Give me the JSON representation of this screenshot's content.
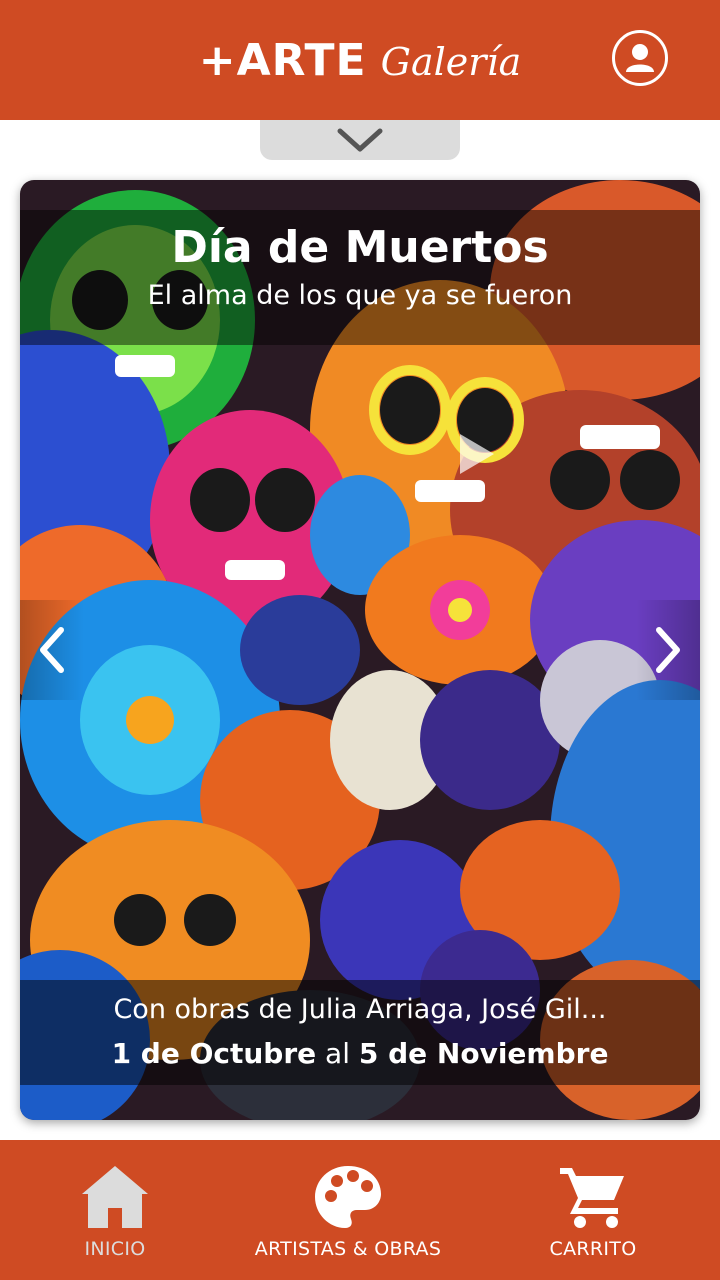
{
  "header": {
    "brand_main": "+ARTE",
    "brand_sub": "Galería",
    "user_icon": "user-profile-icon"
  },
  "pull_tab": {
    "icon": "chevron-down-icon"
  },
  "featured": {
    "title": "Día de Muertos",
    "subtitle": "El alma de los que ya se fueron",
    "artists": "Con obras de Julia Arriaga, José Gil...",
    "date_start": "1 de Octubre",
    "date_connector": "al",
    "date_end": "5 de Noviembre",
    "prev_icon": "chevron-left-icon",
    "next_icon": "chevron-right-icon",
    "play_icon": "play-icon"
  },
  "nav": {
    "items": [
      {
        "label": "INICIO",
        "icon": "home-icon",
        "active": true
      },
      {
        "label": "ARTISTAS & OBRAS",
        "icon": "palette-icon",
        "active": false
      },
      {
        "label": "CARRITO",
        "icon": "cart-icon",
        "active": false
      }
    ]
  },
  "colors": {
    "brand": "#cf4b23",
    "pull_tab": "#dcdcdc",
    "inactive_nav": "#dcdcdc"
  }
}
